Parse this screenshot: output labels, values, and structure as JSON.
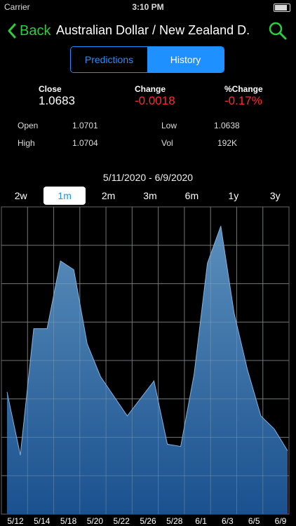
{
  "status": {
    "carrier": "Carrier",
    "time": "3:10 PM"
  },
  "nav": {
    "back_label": "Back",
    "title": "Australian Dollar / New Zealand D..."
  },
  "tabs": {
    "predictions": "Predictions",
    "history": "History"
  },
  "quote": {
    "close_label": "Close",
    "close_value": "1.0683",
    "change_label": "Change",
    "change_value": "-0.0018",
    "pct_label": "%Change",
    "pct_value": "-0.17%",
    "open_label": "Open",
    "open_value": "1.0701",
    "low_label": "Low",
    "low_value": "1.0638",
    "high_label": "High",
    "high_value": "1.0704",
    "vol_label": "Vol",
    "vol_value": "192K"
  },
  "date_range": "5/11/2020 - 6/9/2020",
  "periods": [
    "2w",
    "1m",
    "2m",
    "3m",
    "6m",
    "1y",
    "3y"
  ],
  "selected_period": "1m",
  "colors": {
    "accent_green": "#2ecc40",
    "accent_blue": "#1e90ff",
    "negative_red": "#ff2a2a"
  },
  "chart_data": {
    "type": "area",
    "x": [
      "5/11",
      "5/12",
      "5/13",
      "5/14",
      "5/15",
      "5/18",
      "5/19",
      "5/20",
      "5/21",
      "5/22",
      "5/25",
      "5/26",
      "5/27",
      "5/28",
      "5/29",
      "6/1",
      "6/2",
      "6/3",
      "6/4",
      "6/5",
      "6/8",
      "6/9"
    ],
    "values": [
      0.56,
      0.27,
      0.85,
      0.85,
      1.16,
      1.12,
      0.78,
      0.63,
      0.54,
      0.45,
      0.53,
      0.61,
      0.32,
      0.31,
      0.64,
      1.15,
      1.32,
      0.92,
      0.66,
      0.45,
      0.39,
      0.29
    ],
    "xticks": [
      "5/12",
      "5/14",
      "5/18",
      "5/20",
      "5/22",
      "5/26",
      "5/28",
      "6/1",
      "6/3",
      "6/5",
      "6/9"
    ],
    "grid": true
  }
}
